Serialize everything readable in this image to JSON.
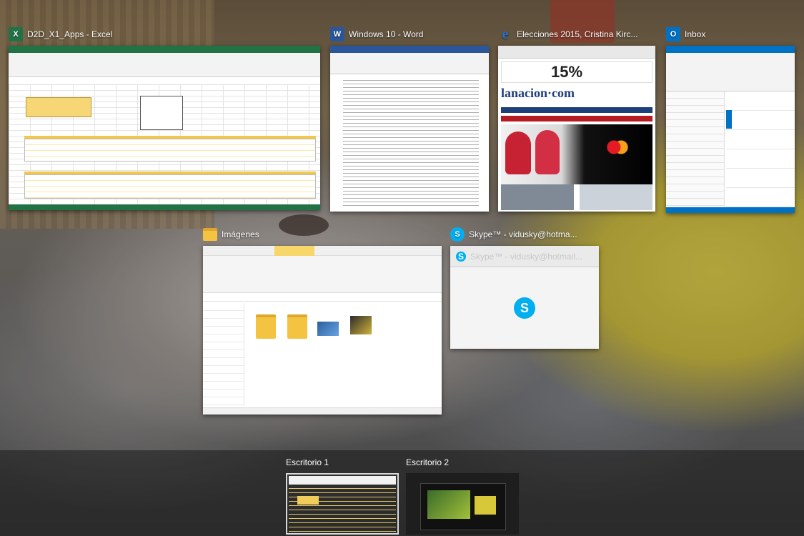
{
  "windows": {
    "excel": {
      "title": "D2D_X1_Apps - Excel",
      "icon": "excel-icon",
      "icon_letter": "X",
      "color": "#217346"
    },
    "word": {
      "title": "Windows 10 - Word",
      "icon": "word-icon",
      "icon_letter": "W",
      "color": "#2b579a"
    },
    "edge": {
      "title": "Elecciones 2015, Cristina Kirc...",
      "icon": "edge-icon",
      "icon_letter": "e",
      "color": "#1e73d2",
      "brand": "lanacion·com",
      "promo": "15%"
    },
    "outlook": {
      "title": "Inbox",
      "icon": "outlook-icon",
      "icon_letter": "O",
      "color": "#0072c6"
    },
    "explorer": {
      "title": "Imágenes",
      "icon": "folder-icon"
    },
    "skype": {
      "title": "Skype™ - vidusky@hotma...",
      "header_text": "Skype™ - vidusky@hotmail...",
      "icon": "skype-icon",
      "icon_letter": "S",
      "color": "#00aff0"
    }
  },
  "desktops": [
    {
      "label": "Escritorio 1",
      "active": true
    },
    {
      "label": "Escritorio 2",
      "active": false
    }
  ]
}
